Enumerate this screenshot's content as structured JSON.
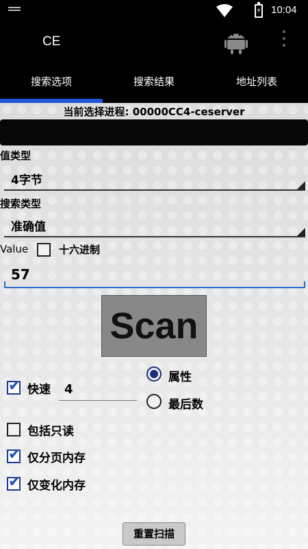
{
  "status_bar": {
    "time": "10:04"
  },
  "action_bar": {
    "title": "CE"
  },
  "tabs": [
    {
      "label": "搜索选项"
    },
    {
      "label": "搜索结果"
    },
    {
      "label": "地址列表"
    }
  ],
  "process_label": "当前选择进程: 00000CC4-ceserver",
  "value_type": {
    "label": "值类型",
    "selected": "4字节"
  },
  "scan_type": {
    "label": "搜索类型",
    "selected": "准确值"
  },
  "value": {
    "label": "Value",
    "hex_label": "十六进制",
    "input": "57"
  },
  "scan_button": "Scan",
  "fast": {
    "label": "快速",
    "value": "4"
  },
  "alignment": {
    "option1": "属性",
    "option2": "最后数"
  },
  "options": {
    "include_readonly": "包括只读",
    "paged_only": "仅分页内存",
    "changed_only": "仅变化内存"
  },
  "reset_button": "重置扫描",
  "colors": {
    "accent": "#1e56d6",
    "checkbox": "#1f4fc0"
  }
}
